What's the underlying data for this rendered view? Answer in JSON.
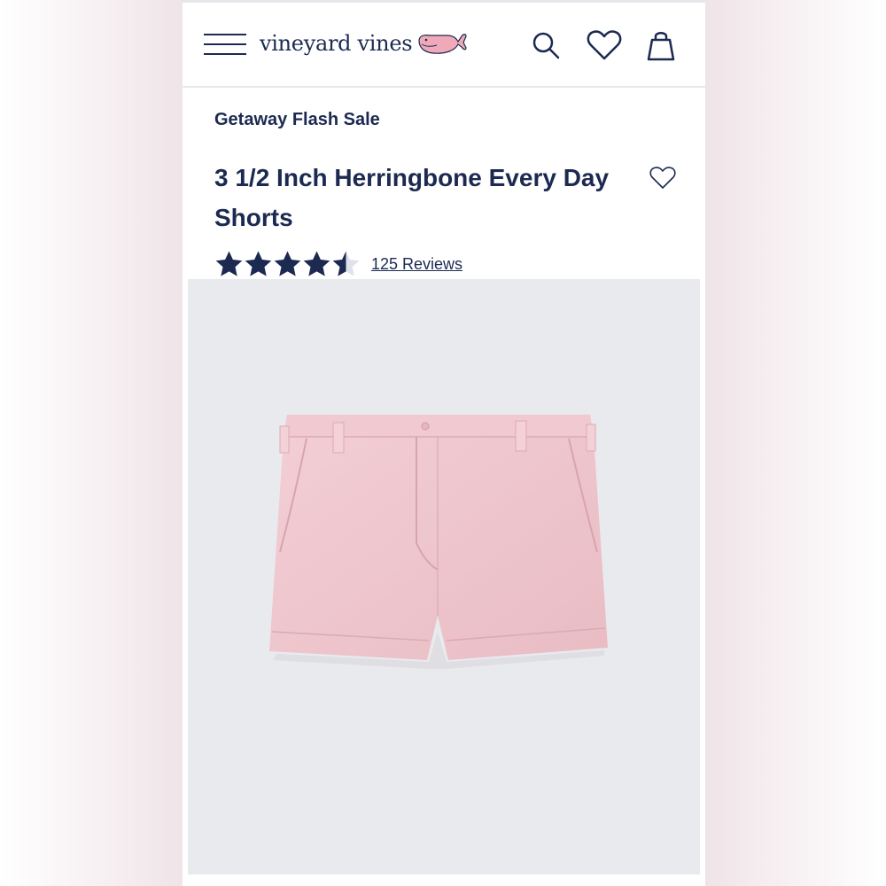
{
  "header": {
    "brand": "vineyard vines",
    "icons": [
      "menu-icon",
      "whale-logo-icon",
      "search-icon",
      "heart-icon",
      "bag-icon"
    ]
  },
  "product": {
    "sale_label": "Getaway Flash Sale",
    "title": "3 1/2 Inch Herringbone Every Day Shorts",
    "rating": 4.5,
    "rating_max": 5,
    "reviews_label": "125 Reviews"
  },
  "colors": {
    "navy": "#1c2a52",
    "pink": "#f0a9b8",
    "product_bg": "#e9eaee",
    "shorts": "#efc6cd"
  }
}
